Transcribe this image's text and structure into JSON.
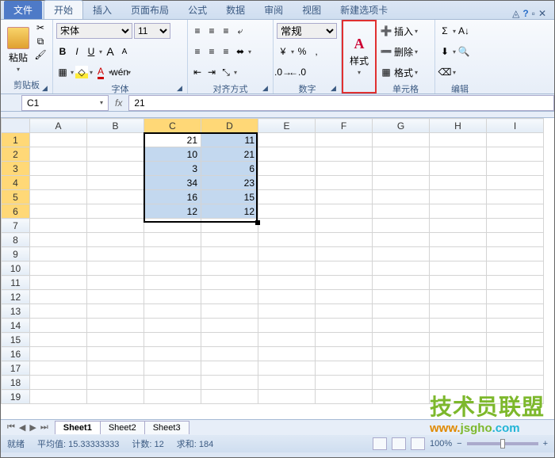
{
  "tabs": {
    "file": "文件",
    "home": "开始",
    "insert": "插入",
    "layout": "页面布局",
    "formulas": "公式",
    "data": "数据",
    "review": "审阅",
    "view": "视图",
    "custom": "新建选项卡"
  },
  "ribbon": {
    "clipboard": {
      "label": "剪贴板",
      "paste": "粘贴"
    },
    "font": {
      "label": "字体",
      "name": "宋体",
      "size": "11"
    },
    "align": {
      "label": "对齐方式"
    },
    "number": {
      "label": "数字",
      "format": "常规"
    },
    "styles": {
      "label": "样式"
    },
    "cells": {
      "label": "单元格",
      "insert": "插入",
      "delete": "删除",
      "format": "格式"
    },
    "editing": {
      "label": "编辑"
    }
  },
  "namebox": "C1",
  "formula": "21",
  "columns": [
    "A",
    "B",
    "C",
    "D",
    "E",
    "F",
    "G",
    "H",
    "I"
  ],
  "rows_visible": 19,
  "selection": {
    "c1": 2,
    "r1": 0,
    "c2": 3,
    "r2": 5
  },
  "cells": {
    "C1": "21",
    "D1": "11",
    "C2": "10",
    "D2": "21",
    "C3": "3",
    "D3": "6",
    "C4": "34",
    "D4": "23",
    "C5": "16",
    "D5": "15",
    "C6": "12",
    "D6": "12"
  },
  "sheets": {
    "active": "Sheet1",
    "list": [
      "Sheet1",
      "Sheet2",
      "Sheet3"
    ]
  },
  "status": {
    "ready": "就绪",
    "avg_label": "平均值:",
    "avg": "15.33333333",
    "count_label": "计数:",
    "count": "12",
    "sum_label": "求和:",
    "sum": "184",
    "zoom": "100%"
  },
  "watermark": {
    "main": "技术员联盟",
    "url_w": "www.",
    "url_j": "jsgho",
    "url_c": ".com"
  }
}
